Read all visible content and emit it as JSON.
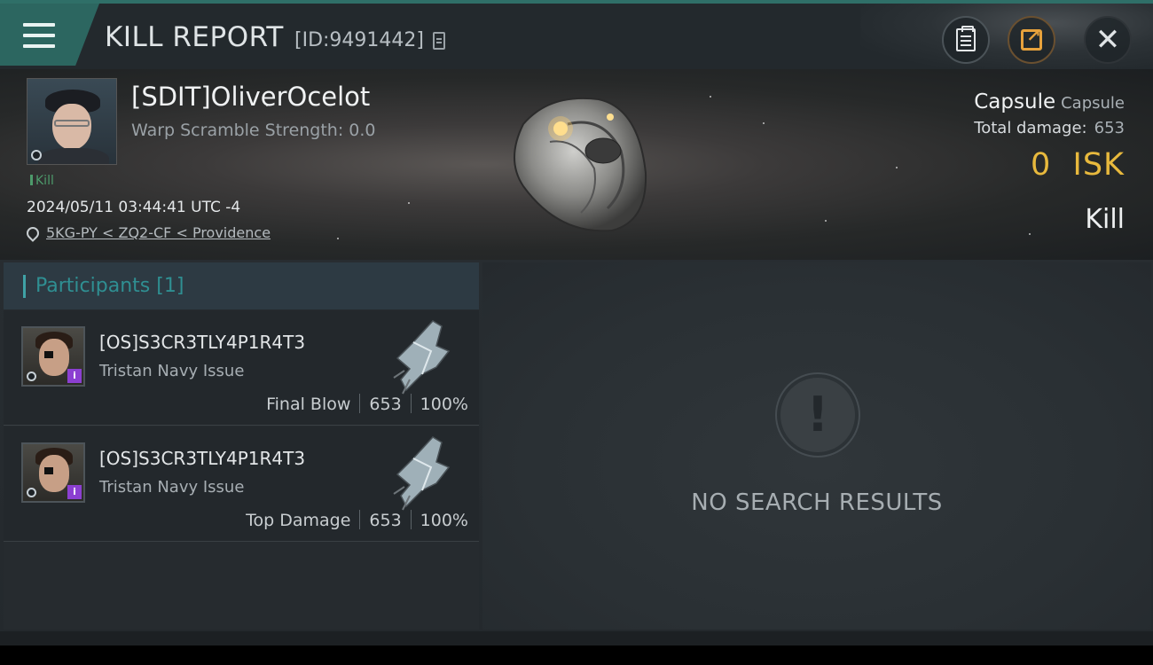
{
  "header": {
    "title": "KILL REPORT",
    "report_id": "[ID:9491442]",
    "icons": [
      "menu-icon",
      "copy-id-icon",
      "clipboard-icon",
      "share-icon",
      "close-icon"
    ],
    "close_glyph": "✕"
  },
  "victim": {
    "name": "[SDIT]OliverOcelot",
    "warp_scramble": "Warp Scramble Strength: 0.0",
    "tag": "Kill",
    "datetime": "2024/05/11 03:44:41 UTC -4",
    "location": "5KG-PY < ZQ2-CF < Providence",
    "ship_name": "Capsule",
    "ship_class": "Capsule",
    "total_damage_label": "Total damage:",
    "total_damage_value": "653",
    "isk_value": "0",
    "isk_unit": "ISK",
    "result": "Kill"
  },
  "participants": {
    "heading": "Participants",
    "count": "[1]",
    "rows": [
      {
        "name": "[OS]S3CR3TLY4P1R4T3",
        "ship": "Tristan Navy Issue",
        "role": "Final Blow",
        "damage": "653",
        "percent": "100%",
        "alpha_badge": "i"
      },
      {
        "name": "[OS]S3CR3TLY4P1R4T3",
        "ship": "Tristan Navy Issue",
        "role": "Top Damage",
        "damage": "653",
        "percent": "100%",
        "alpha_badge": "i"
      }
    ]
  },
  "results_panel": {
    "empty_glyph": "!",
    "empty_message": "NO SEARCH RESULTS"
  },
  "colors": {
    "accent_teal": "#2c6660",
    "isk_gold": "#e8b93d",
    "participants_teal": "#2f8f92",
    "alpha_purple": "#8b3fd1",
    "kill_green": "#4d9a6b"
  }
}
